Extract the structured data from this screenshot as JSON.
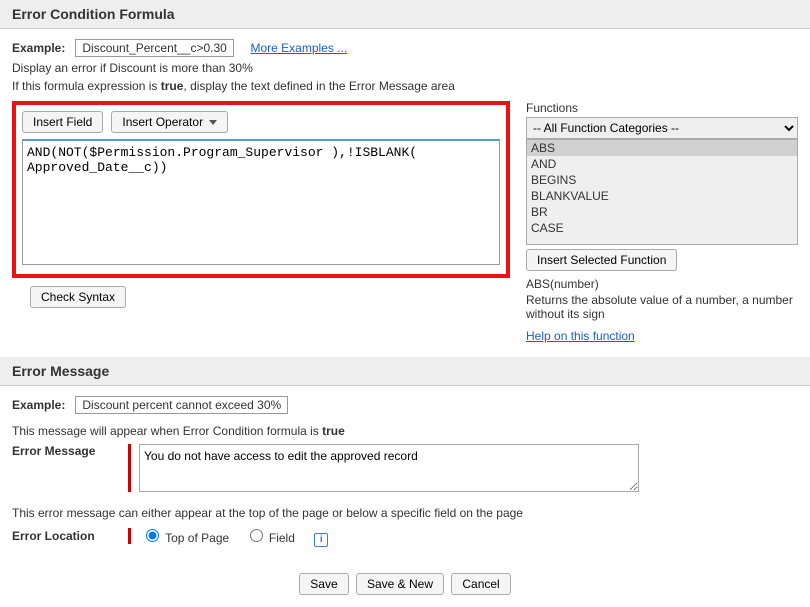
{
  "sections": {
    "formula_header": "Error Condition Formula",
    "message_header": "Error Message"
  },
  "formula": {
    "example_label": "Example:",
    "example_value": "Discount_Percent__c>0.30",
    "more_examples": "More Examples ...",
    "desc1": "Display an error if Discount is more than 30%",
    "desc2_prefix": "If this formula expression is ",
    "desc2_bold": "true",
    "desc2_suffix": ", display the text defined in the Error Message area",
    "insert_field_btn": "Insert Field",
    "insert_op_btn": "Insert Operator",
    "code": "AND(NOT($Permission.Program_Supervisor ),!ISBLANK( Approved_Date__c))",
    "check_syntax_btn": "Check Syntax"
  },
  "functions": {
    "label": "Functions",
    "category_selected": "-- All Function Categories --",
    "items": [
      "ABS",
      "AND",
      "BEGINS",
      "BLANKVALUE",
      "BR",
      "CASE"
    ],
    "insert_btn": "Insert Selected Function",
    "signature": "ABS(number)",
    "description": "Returns the absolute value of a number, a number without its sign",
    "help_link": "Help on this function"
  },
  "error_message": {
    "example_label": "Example:",
    "example_value": "Discount percent cannot exceed 30%",
    "appear_prefix": "This message will appear when Error Condition formula is ",
    "appear_bold": "true",
    "field_label": "Error Message",
    "value": "You do not have access to edit the approved record",
    "appear_note": "This error message can either appear at the top of the page or below a specific field on the page",
    "location_label": "Error Location",
    "radio_top": "Top of Page",
    "radio_field": "Field"
  },
  "footer": {
    "save": "Save",
    "save_new": "Save & New",
    "cancel": "Cancel"
  }
}
